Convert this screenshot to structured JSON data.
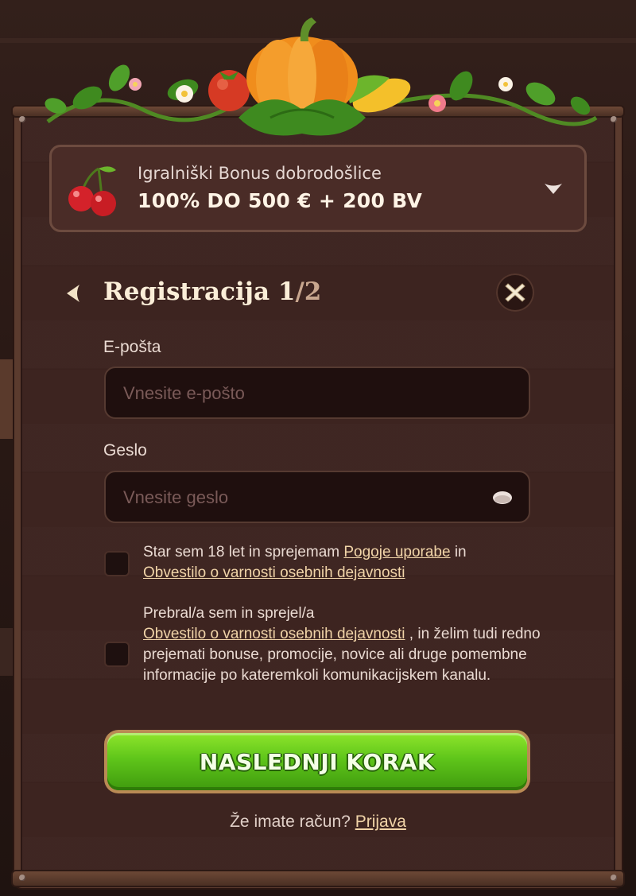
{
  "bonus": {
    "subtitle": "Igralniški Bonus dobrodošlice",
    "title": "100% DO 500 € + 200 BV"
  },
  "header": {
    "title": "Registracija 1",
    "step": "/2"
  },
  "email": {
    "label": "E-pošta",
    "placeholder": "Vnesite e-pošto",
    "value": ""
  },
  "password": {
    "label": "Geslo",
    "placeholder": "Vnesite geslo",
    "value": ""
  },
  "consent_terms": {
    "text_before": "Star sem 18 let in sprejemam ",
    "link_terms": "Pogoje uporabe",
    "text_mid": " in",
    "link_privacy": "Obvestilo o varnosti osebnih dejavnosti",
    "checked": false
  },
  "consent_marketing": {
    "text_before": "Prebral/a sem in sprejel/a",
    "link_privacy": "Obvestilo o varnosti osebnih dejavnosti",
    "text_after": " , in želim tudi redno prejemati bonuse, promocije, novice ali druge pomembne informacije po kateremkoli komunikacijskem kanalu.",
    "checked": false
  },
  "next_button": {
    "label": "NASLEDNJI KORAK"
  },
  "login": {
    "prompt": "Že imate račun? ",
    "link": "Prijava"
  },
  "icons": {
    "decoration": "harvest-garland-pumpkin",
    "bonus": "cherry-icon",
    "back": "chevron-left-icon",
    "close": "close-icon",
    "show_password": "eye-icon",
    "expand": "chevron-down-icon"
  },
  "colors": {
    "panel": "#3d2420",
    "accent_green": "#5fc51a",
    "link": "#f1d4a8"
  }
}
